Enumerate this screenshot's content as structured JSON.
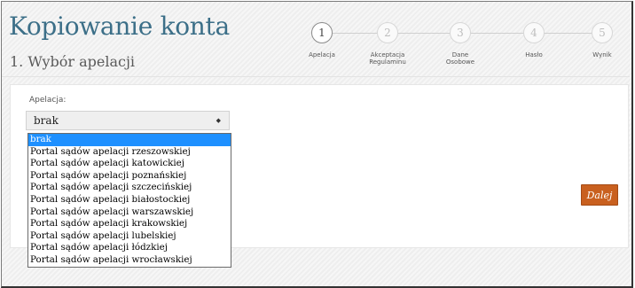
{
  "header": {
    "title": "Kopiowanie konta",
    "subtitle": "1. Wybór apelacji"
  },
  "steps": [
    {
      "number": "1",
      "label": "Apelacja",
      "active": true
    },
    {
      "number": "2",
      "label": "Akceptacja Regulaminu",
      "active": false
    },
    {
      "number": "3",
      "label": "Dane Osobowe",
      "active": false
    },
    {
      "number": "4",
      "label": "Hasło",
      "active": false
    },
    {
      "number": "5",
      "label": "Wynik",
      "active": false
    }
  ],
  "form": {
    "field_label": "Apelacja:",
    "selected_value": "brak",
    "options": [
      "brak",
      "Portal sądów apelacji rzeszowskiej",
      "Portal sądów apelacji katowickiej",
      "Portal sądów apelacji poznańskiej",
      "Portal sądów apelacji szczecińskiej",
      "Portal sądów apelacji białostockiej",
      "Portal sądów apelacji warszawskiej",
      "Portal sądów apelacji krakowskiej",
      "Portal sądów apelacji lubelskiej",
      "Portal sądów apelacji łódzkiej",
      "Portal sądów apelacji wrocławskiej"
    ]
  },
  "actions": {
    "next_label": "Dalej"
  },
  "colors": {
    "title": "#3c6f88",
    "accent_button": "#c9601f",
    "option_highlight": "#1e90ff"
  }
}
